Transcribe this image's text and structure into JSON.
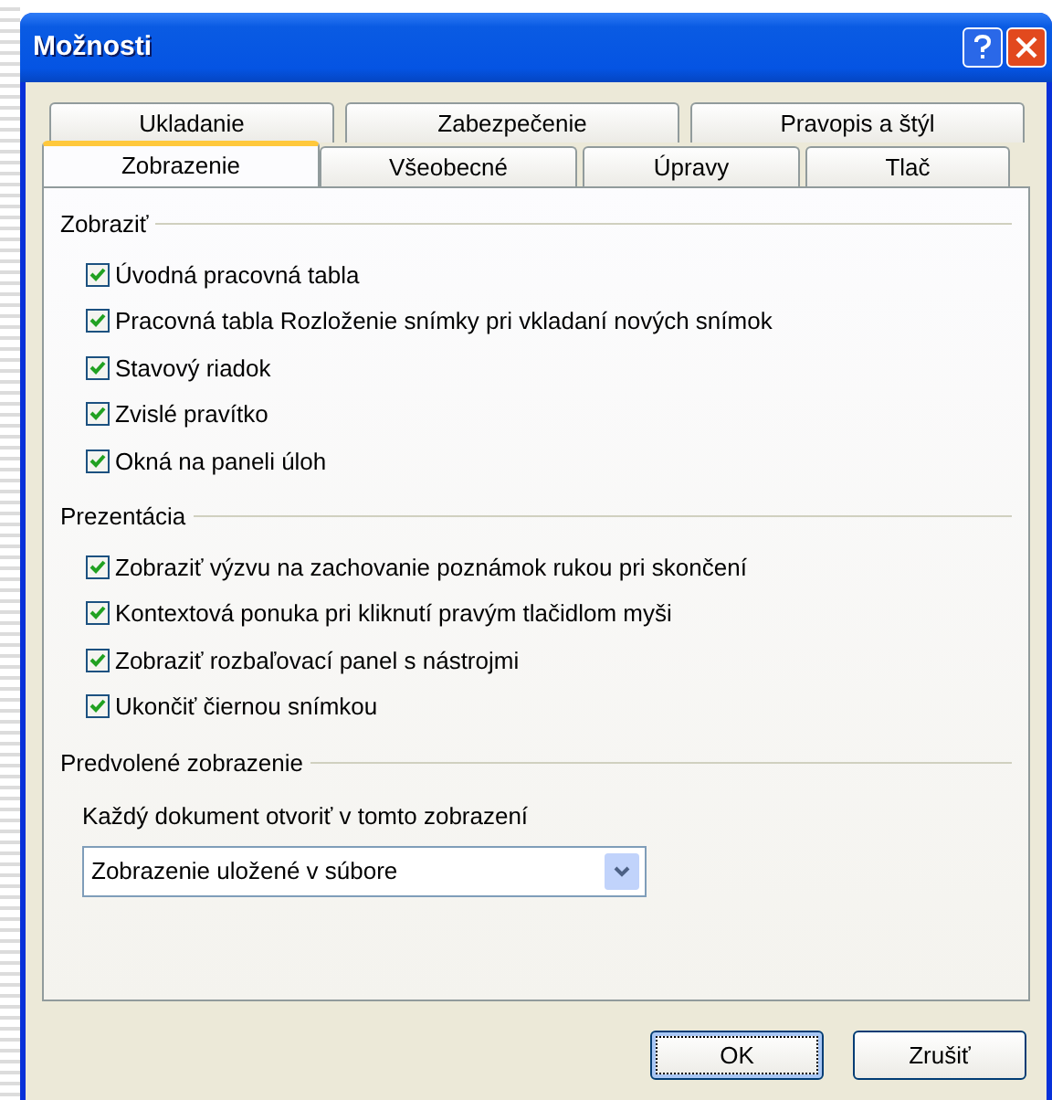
{
  "window": {
    "title": "Možnosti"
  },
  "tab_rows": [
    [
      {
        "label": "Ukladanie",
        "selected": false
      },
      {
        "label": "Zabezpečenie",
        "selected": false
      },
      {
        "label": "Pravopis a štýl",
        "selected": false
      }
    ],
    [
      {
        "label": "Zobrazenie",
        "selected": true
      },
      {
        "label": "Všeobecné",
        "selected": false
      },
      {
        "label": "Úpravy",
        "selected": false
      },
      {
        "label": "Tlač",
        "selected": false
      }
    ]
  ],
  "sections": [
    {
      "kind": "checkboxes",
      "title": "Zobraziť",
      "items": [
        {
          "label": "Úvodná pracovná tabla",
          "checked": true
        },
        {
          "label": "Pracovná tabla Rozloženie snímky pri vkladaní nových snímok",
          "checked": true
        },
        {
          "label": "Stavový riadok",
          "checked": true
        },
        {
          "label": "Zvislé pravítko",
          "checked": true
        },
        {
          "label": "Okná na paneli úloh",
          "checked": true
        }
      ]
    },
    {
      "kind": "checkboxes",
      "title": "Prezentácia",
      "items": [
        {
          "label": "Zobraziť výzvu na zachovanie poznámok rukou pri skončení",
          "checked": true
        },
        {
          "label": "Kontextová ponuka pri kliknutí pravým tlačidlom myši",
          "checked": true
        },
        {
          "label": "Zobraziť rozbaľovací panel s nástrojmi",
          "checked": true
        },
        {
          "label": "Ukončiť čiernou snímkou",
          "checked": true
        }
      ]
    },
    {
      "kind": "dropdown",
      "title": "Predvolené zobrazenie",
      "field_label": "Každý dokument otvoriť v tomto zobrazení",
      "value": "Zobrazenie uložené v súbore"
    }
  ],
  "buttons": [
    {
      "label": "OK",
      "focused": true
    },
    {
      "label": "Zrušiť",
      "focused": false
    }
  ]
}
